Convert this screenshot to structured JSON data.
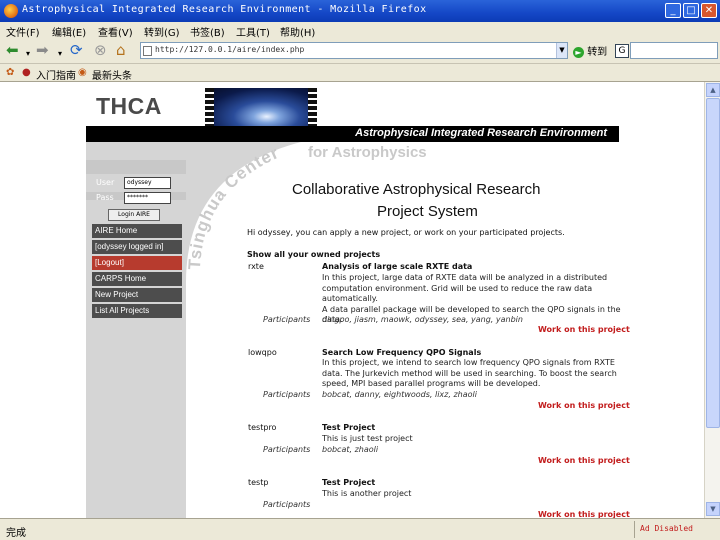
{
  "window": {
    "title": "Astrophysical Integrated Research Environment - Mozilla Firefox",
    "controls": {
      "minimize": "_",
      "maximize": "□",
      "close": "✕"
    }
  },
  "menu": {
    "file": "文件(F)",
    "edit": "编辑(E)",
    "view": "查看(V)",
    "go": "转到(G)",
    "bookmarks": "书签(B)",
    "tools": "工具(T)",
    "help": "帮助(H)"
  },
  "toolbar": {
    "back": "back",
    "forward": "forward",
    "reload": "reload",
    "stop": "stop",
    "home": "home",
    "url": "http://127.0.0.1/aire/index.php",
    "go_label": "转到"
  },
  "bookmarks": {
    "items": [
      "入门指南",
      "最新头条"
    ]
  },
  "page": {
    "logo": "THCA",
    "banner_text": "Astrophysical Integrated Research Environment",
    "tsinghua_text": "Tsinghua Center",
    "for_astro": "for Astrophysics",
    "heading_line1": "Collaborative Astrophysical Research",
    "heading_line2": "Project System",
    "login": {
      "user_label": "User",
      "user_value": "odyssey",
      "pass_label": "Pass",
      "pass_value": "*******",
      "button": "Login  AIRE"
    },
    "nav": [
      "AIRE Home",
      "[odyssey logged in]",
      "[Logout]",
      "CARPS Home",
      "New Project",
      "List All Projects"
    ],
    "intro": "Hi odyssey, you can apply a new project, or work on your participated projects.",
    "show_all": "Show all your owned projects",
    "participants_label": "Participants",
    "work_label": "Work on this project",
    "projects": [
      {
        "id": "rxte",
        "title": "Analysis of large scale RXTE data",
        "desc": [
          "In this project, large data of RXTE data will be analyzed in a distributed",
          "computation environment. Grid will be used to reduce the raw data automatically.",
          "A data parallel package will be developed to search the QPO signals in the",
          "data."
        ],
        "participants": "dingpo, jiasm, maowk, odyssey, sea, yang, yanbin"
      },
      {
        "id": "lowqpo",
        "title": "Search Low Frequency QPO Signals",
        "desc": [
          "In this project, we intend to search low frequency QPO signals from RXTE",
          "data. The Jurkevich method will be used in searching. To boost the search",
          "speed, MPI based parallel programs will be developed."
        ],
        "participants": "bobcat, danny, eightwoods, lixz, zhaoli"
      },
      {
        "id": "testpro",
        "title": "Test Project",
        "desc": [
          "This is just test project"
        ],
        "participants": "bobcat, zhaoli"
      },
      {
        "id": "testp",
        "title": "Test Project",
        "desc": [
          "This is another project"
        ],
        "participants": ""
      }
    ]
  },
  "status": {
    "text": "完成",
    "adblock": "Ad Disabled"
  }
}
